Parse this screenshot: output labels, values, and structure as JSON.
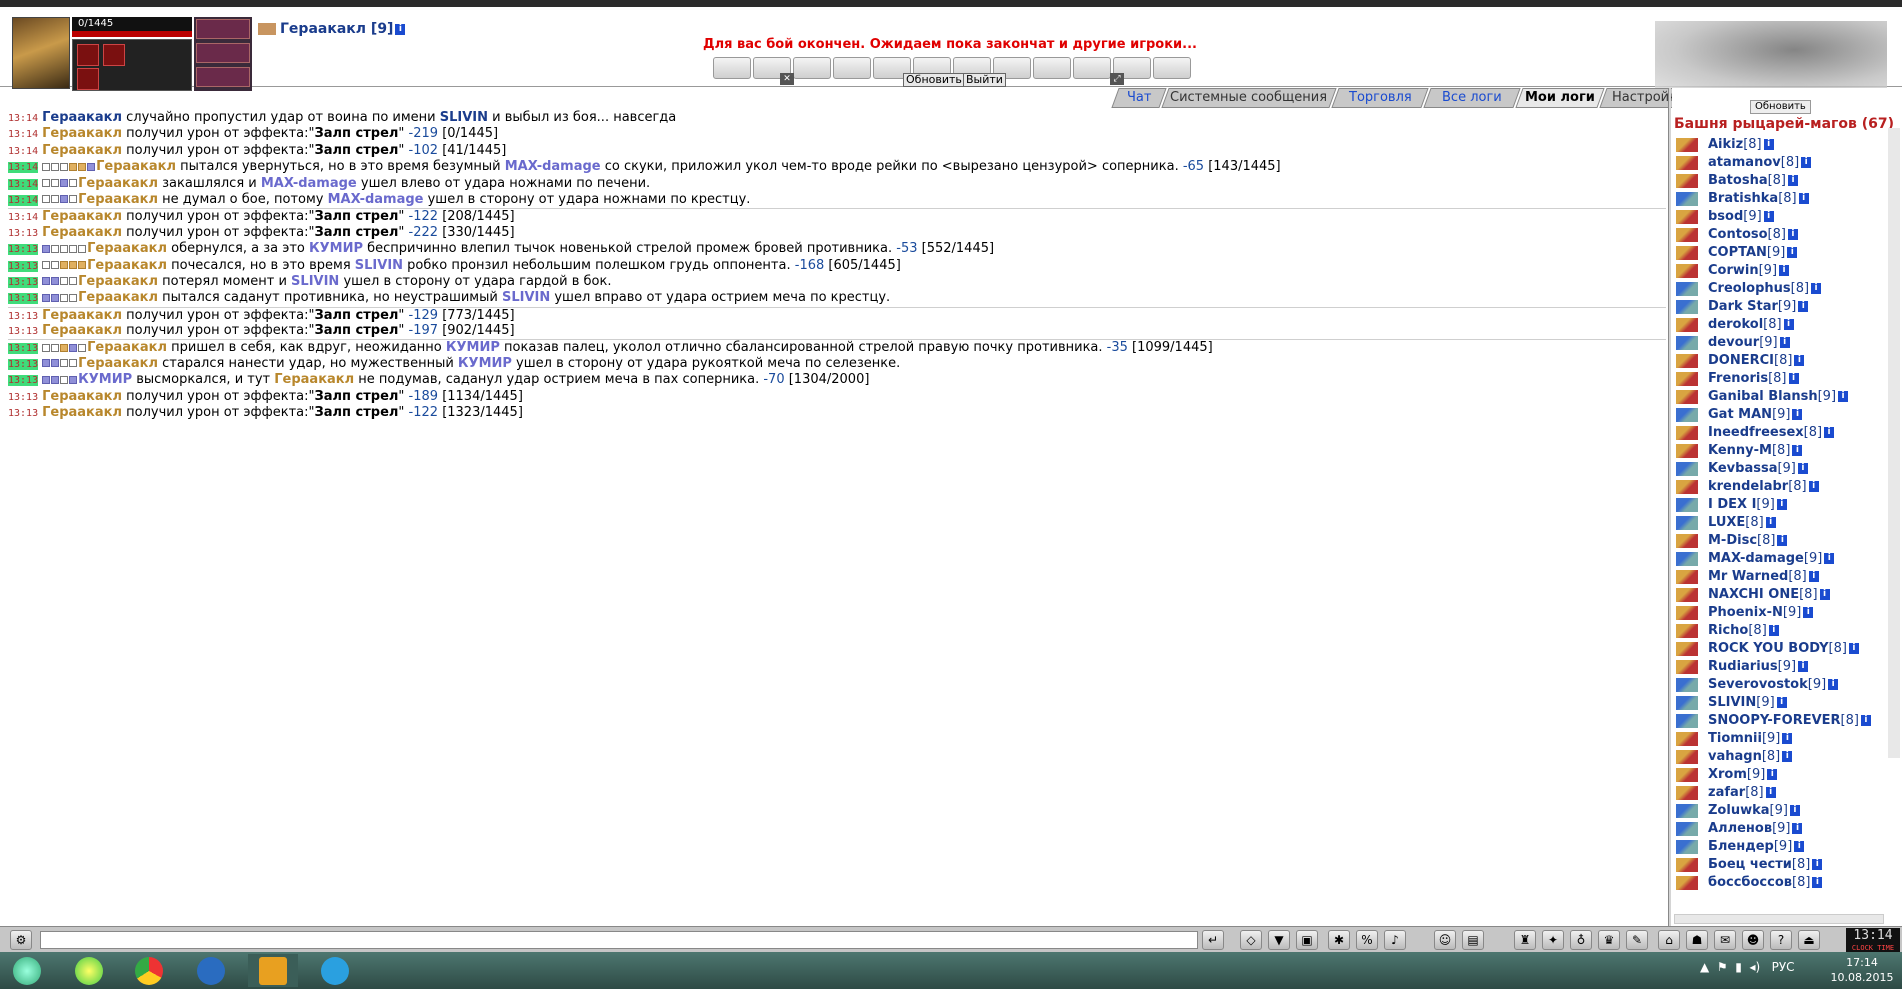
{
  "header": {
    "hp_text": "0/1445",
    "player_name": "Гераакакл",
    "player_level": "[9]",
    "battle_message": "Для вас бой окончен. Ожидаем пока закончат и другие игроки...",
    "refresh_label": "Обновить",
    "exit_label": "Выйти"
  },
  "tabs": [
    {
      "label": "Чат",
      "color": "blue"
    },
    {
      "label": "Системные сообщения",
      "color": "dark"
    },
    {
      "label": "Торговля",
      "color": "blue"
    },
    {
      "label": "Все логи",
      "color": "blue"
    },
    {
      "label": "Мои логи",
      "color": "active"
    },
    {
      "label": "Настройки",
      "color": "dark"
    }
  ],
  "log": [
    {
      "time": "13:14",
      "hl": false,
      "squares": "",
      "parts": [
        [
          "hero",
          "Гераакакл"
        ],
        [
          "t",
          " случайно пропустил удар от воина по имени "
        ],
        [
          "hero",
          "SLIVIN"
        ],
        [
          "t",
          " и выбыл из боя... навсегда"
        ]
      ]
    },
    {
      "time": "13:14",
      "hl": false,
      "squares": "",
      "parts": [
        [
          "me",
          "Гераакакл"
        ],
        [
          "t",
          " получил урон от эффекта:\""
        ],
        [
          "eff",
          "Залп стрел"
        ],
        [
          "t",
          "\" "
        ],
        [
          "dmg",
          "-219"
        ],
        [
          "t",
          " [0/1445]"
        ]
      ]
    },
    {
      "time": "13:14",
      "hl": false,
      "squares": "",
      "parts": [
        [
          "me",
          "Гераакакл"
        ],
        [
          "t",
          " получил урон от эффекта:\""
        ],
        [
          "eff",
          "Залп стрел"
        ],
        [
          "t",
          "\" "
        ],
        [
          "dmg",
          "-102"
        ],
        [
          "t",
          " [41/1445]"
        ]
      ]
    },
    {
      "time": "13:14",
      "hl": true,
      "squares": "oooffd",
      "parts": [
        [
          "me",
          "Гераакакл"
        ],
        [
          "t",
          " пытался увернуться, но в это время безумный "
        ],
        [
          "en",
          "MAX-damage"
        ],
        [
          "t",
          " со скуки, приложил укол чем-то вроде рейки по <вырезано цензурой> соперника. "
        ],
        [
          "dmg",
          "-65"
        ],
        [
          "t",
          " [143/1445]"
        ]
      ]
    },
    {
      "time": "13:14",
      "hl": true,
      "squares": "oodo",
      "parts": [
        [
          "me",
          "Гераакакл"
        ],
        [
          "t",
          " закашлялся и "
        ],
        [
          "en",
          "MAX-damage"
        ],
        [
          "t",
          " ушел влево от удара ножнами по печени."
        ]
      ]
    },
    {
      "time": "13:14",
      "hl": true,
      "squares": "oodo",
      "parts": [
        [
          "me",
          "Гераакакл"
        ],
        [
          "t",
          " не думал о бое, потому "
        ],
        [
          "en",
          "MAX-damage"
        ],
        [
          "t",
          " ушел в сторону от удара ножнами по крестцу."
        ]
      ]
    },
    {
      "time": "13:14",
      "hl": false,
      "squares": "",
      "sep": true,
      "parts": [
        [
          "me",
          "Гераакакл"
        ],
        [
          "t",
          " получил урон от эффекта:\""
        ],
        [
          "eff",
          "Залп стрел"
        ],
        [
          "t",
          "\" "
        ],
        [
          "dmg",
          "-122"
        ],
        [
          "t",
          " [208/1445]"
        ]
      ]
    },
    {
      "time": "13:13",
      "hl": false,
      "squares": "",
      "parts": [
        [
          "me",
          "Гераакакл"
        ],
        [
          "t",
          " получил урон от эффекта:\""
        ],
        [
          "eff",
          "Залп стрел"
        ],
        [
          "t",
          "\" "
        ],
        [
          "dmg",
          "-222"
        ],
        [
          "t",
          " [330/1445]"
        ]
      ]
    },
    {
      "time": "13:13",
      "hl": true,
      "squares": "doooo",
      "parts": [
        [
          "me",
          "Гераакакл"
        ],
        [
          "t",
          " обернулся, а за это "
        ],
        [
          "en",
          "КУМИР"
        ],
        [
          "t",
          " беспричинно влепил тычок новенькой стрелой промеж бровей противника. "
        ],
        [
          "dmg",
          "-53"
        ],
        [
          "t",
          " [552/1445]"
        ]
      ]
    },
    {
      "time": "13:13",
      "hl": true,
      "squares": "oofff",
      "parts": [
        [
          "me",
          "Гераакакл"
        ],
        [
          "t",
          " почесался, но в это время "
        ],
        [
          "en",
          "SLIVIN"
        ],
        [
          "t",
          " робко пронзил небольшим полешком грудь оппонента. "
        ],
        [
          "dmg",
          "-168"
        ],
        [
          "t",
          " [605/1445]"
        ]
      ]
    },
    {
      "time": "13:13",
      "hl": true,
      "squares": "ddoo",
      "parts": [
        [
          "me",
          "Гераакакл"
        ],
        [
          "t",
          " потерял момент и "
        ],
        [
          "en",
          "SLIVIN"
        ],
        [
          "t",
          " ушел в сторону от удара гардой в бок."
        ]
      ]
    },
    {
      "time": "13:13",
      "hl": true,
      "squares": "ddoo",
      "parts": [
        [
          "me",
          "Гераакакл"
        ],
        [
          "t",
          " пытался саданут противника, но неустрашимый "
        ],
        [
          "en",
          "SLIVIN"
        ],
        [
          "t",
          " ушел вправо от удара острием меча по крестцу."
        ]
      ]
    },
    {
      "time": "13:13",
      "hl": false,
      "squares": "",
      "sep": true,
      "parts": [
        [
          "me",
          "Гераакакл"
        ],
        [
          "t",
          " получил урон от эффекта:\""
        ],
        [
          "eff",
          "Залп стрел"
        ],
        [
          "t",
          "\" "
        ],
        [
          "dmg",
          "-129"
        ],
        [
          "t",
          " [773/1445]"
        ]
      ]
    },
    {
      "time": "13:13",
      "hl": false,
      "squares": "",
      "parts": [
        [
          "me",
          "Гераакакл"
        ],
        [
          "t",
          " получил урон от эффекта:\""
        ],
        [
          "eff",
          "Залп стрел"
        ],
        [
          "t",
          "\" "
        ],
        [
          "dmg",
          "-197"
        ],
        [
          "t",
          " [902/1445]"
        ]
      ]
    },
    {
      "time": "13:13",
      "hl": true,
      "squares": "oofdo",
      "sep": true,
      "parts": [
        [
          "me",
          "Гераакакл"
        ],
        [
          "t",
          " пришел в себя, как вдруг, неожиданно "
        ],
        [
          "en",
          "КУМИР"
        ],
        [
          "t",
          " показав палец, уколол отлично сбалансированной стрелой правую почку противника. "
        ],
        [
          "dmg",
          "-35"
        ],
        [
          "t",
          " [1099/1445]"
        ]
      ]
    },
    {
      "time": "13:13",
      "hl": true,
      "squares": "ddoo",
      "parts": [
        [
          "me",
          "Гераакакл"
        ],
        [
          "t",
          " старался нанести удар, но мужественный "
        ],
        [
          "en",
          "КУМИР"
        ],
        [
          "t",
          " ушел в сторону от удара рукояткой меча по селезенке."
        ]
      ]
    },
    {
      "time": "13:13",
      "hl": true,
      "squares": "ddod",
      "parts": [
        [
          "en",
          "КУМИР"
        ],
        [
          "t",
          " высморкался, и тут "
        ],
        [
          "me",
          "Гераакакл"
        ],
        [
          "t",
          " не подумав, саданул удар острием меча в пах соперника. "
        ],
        [
          "dmg",
          "-70"
        ],
        [
          "t",
          " [1304/2000]"
        ]
      ]
    },
    {
      "time": "13:13",
      "hl": false,
      "squares": "",
      "parts": [
        [
          "me",
          "Гераакакл"
        ],
        [
          "t",
          " получил урон от эффекта:\""
        ],
        [
          "eff",
          "Залп стрел"
        ],
        [
          "t",
          "\" "
        ],
        [
          "dmg",
          "-189"
        ],
        [
          "t",
          " [1134/1445]"
        ]
      ]
    },
    {
      "time": "13:13",
      "hl": false,
      "squares": "",
      "parts": [
        [
          "me",
          "Гераакакл"
        ],
        [
          "t",
          " получил урон от эффекта:\""
        ],
        [
          "eff",
          "Залп стрел"
        ],
        [
          "t",
          "\" "
        ],
        [
          "dmg",
          "-122"
        ],
        [
          "t",
          " [1323/1445]"
        ]
      ]
    }
  ],
  "sidebar": {
    "refresh_label": "Обновить",
    "title": "Башня рыцарей-магов (67)",
    "players": [
      {
        "name": "Aikiz",
        "lv": "[8]",
        "ic": "a"
      },
      {
        "name": "atamanov",
        "lv": "[8]",
        "ic": "a"
      },
      {
        "name": "Batosha",
        "lv": "[8]",
        "ic": "a"
      },
      {
        "name": "Bratishka",
        "lv": "[8]",
        "ic": "b"
      },
      {
        "name": "bsod",
        "lv": "[9]",
        "ic": "a"
      },
      {
        "name": "Contoso",
        "lv": "[8]",
        "ic": "a"
      },
      {
        "name": "COPTAN",
        "lv": "[9]",
        "ic": "a"
      },
      {
        "name": "Corwin",
        "lv": "[9]",
        "ic": "a"
      },
      {
        "name": "Creolophus",
        "lv": "[8]",
        "ic": "b"
      },
      {
        "name": "Dark Star",
        "lv": "[9]",
        "ic": "b"
      },
      {
        "name": "derokol",
        "lv": "[8]",
        "ic": "a"
      },
      {
        "name": "devour",
        "lv": "[9]",
        "ic": "b"
      },
      {
        "name": "DONERCI",
        "lv": "[8]",
        "ic": "a"
      },
      {
        "name": "Frenoris",
        "lv": "[8]",
        "ic": "a"
      },
      {
        "name": "Ganibal Blansh",
        "lv": "[9]",
        "ic": "a"
      },
      {
        "name": "Gat MAN",
        "lv": "[9]",
        "ic": "b"
      },
      {
        "name": "Ineedfreesex",
        "lv": "[8]",
        "ic": "a"
      },
      {
        "name": "Kenny-M",
        "lv": "[8]",
        "ic": "a"
      },
      {
        "name": "Kevbassa",
        "lv": "[9]",
        "ic": "b"
      },
      {
        "name": "krendelabr",
        "lv": "[8]",
        "ic": "a"
      },
      {
        "name": "I DEX I",
        "lv": "[9]",
        "ic": "b"
      },
      {
        "name": "LUXE",
        "lv": "[8]",
        "ic": "b"
      },
      {
        "name": "M-Disc",
        "lv": "[8]",
        "ic": "a"
      },
      {
        "name": "MAX-damage",
        "lv": "[9]",
        "ic": "b"
      },
      {
        "name": "Mr Warned",
        "lv": "[8]",
        "ic": "a"
      },
      {
        "name": "NAXCHI ONE",
        "lv": "[8]",
        "ic": "a"
      },
      {
        "name": "Phoenix-N",
        "lv": "[9]",
        "ic": "a"
      },
      {
        "name": "Richo",
        "lv": "[8]",
        "ic": "a"
      },
      {
        "name": "ROCK YOU BODY",
        "lv": "[8]",
        "ic": "a"
      },
      {
        "name": "Rudiarius",
        "lv": "[9]",
        "ic": "a"
      },
      {
        "name": "Severovostok",
        "lv": "[9]",
        "ic": "b"
      },
      {
        "name": "SLIVIN",
        "lv": "[9]",
        "ic": "b"
      },
      {
        "name": "SNOOPY-FOREVER",
        "lv": "[8]",
        "ic": "b"
      },
      {
        "name": "Tiomnii",
        "lv": "[9]",
        "ic": "a"
      },
      {
        "name": "vahagn",
        "lv": "[8]",
        "ic": "a"
      },
      {
        "name": "Xrom",
        "lv": "[9]",
        "ic": "a"
      },
      {
        "name": "zafar",
        "lv": "[8]",
        "ic": "a"
      },
      {
        "name": "Zoluwka",
        "lv": "[9]",
        "ic": "b"
      },
      {
        "name": "Алленов",
        "lv": "[9]",
        "ic": "b"
      },
      {
        "name": "Блендер",
        "lv": "[9]",
        "ic": "b"
      },
      {
        "name": "Боец чести",
        "lv": "[8]",
        "ic": "a"
      },
      {
        "name": "боссбоссов",
        "lv": "[8]",
        "ic": "a"
      }
    ]
  },
  "bottom": {
    "clock_time": "13:14",
    "clock_label": "CLOCK TIME"
  },
  "taskbar": {
    "lang": "РУС",
    "time": "17:14",
    "date": "10.08.2015"
  },
  "colors": {
    "accent": "#1a3c8c",
    "me": "#b8872c",
    "enemy": "#6a6acd",
    "alert": "#e00000",
    "log_highlight": "#3fdc7a"
  }
}
